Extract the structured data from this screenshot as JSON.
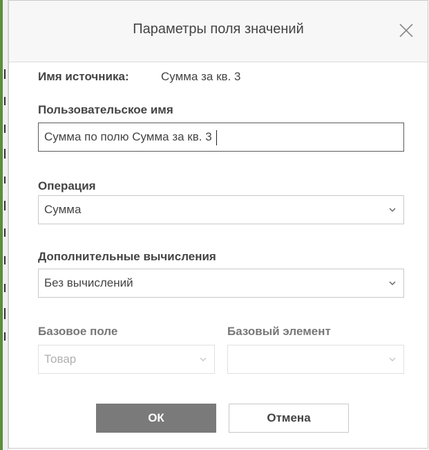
{
  "dialog": {
    "title": "Параметры поля значений",
    "close_icon": "close-icon"
  },
  "source": {
    "label": "Имя источника:",
    "value": "Сумма за кв. 3"
  },
  "custom_name": {
    "label": "Пользовательское имя",
    "value": "Сумма по полю  Сумма за кв. 3"
  },
  "operation": {
    "label": "Операция",
    "selected": "Сумма"
  },
  "extra_calc": {
    "label": "Дополнительные вычисления",
    "selected": "Без вычислений"
  },
  "base_field": {
    "label": "Базовое поле",
    "selected": "Товар"
  },
  "base_item": {
    "label": "Базовый элемент",
    "selected": ""
  },
  "buttons": {
    "ok": "ОК",
    "cancel": "Отмена"
  },
  "colors": {
    "primary_button": "#7a7a7a",
    "text": "#444444",
    "accent_strip": "#5a8f3c"
  }
}
